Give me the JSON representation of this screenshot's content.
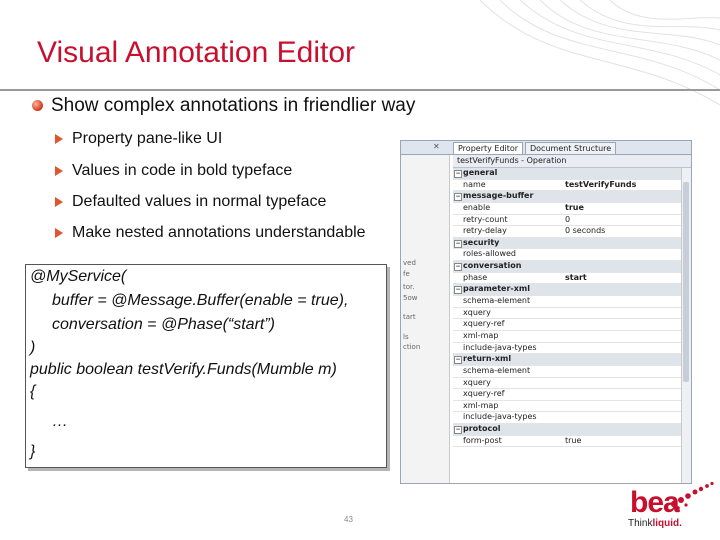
{
  "slide": {
    "title": "Visual Annotation Editor",
    "bullet": "Show complex annotations in friendlier way",
    "sub_bullets": [
      "Property pane-like UI",
      "Values in code in bold typeface",
      "Defaulted values in normal typeface",
      "Make nested annotations understandable"
    ],
    "page_number": "43",
    "brand_color": "#c8102e"
  },
  "code": {
    "lines": [
      "@MyService(",
      "buffer = @Message.Buffer(enable = true),",
      "conversation = @Phase(“start”)",
      ")",
      "public boolean testVerify.Funds(Mumble m)",
      "{",
      "…",
      "}"
    ]
  },
  "editor": {
    "tabs": [
      "Property Editor",
      "Document Structure"
    ],
    "header": "testVerifyFunds - Operation",
    "left_fragments": [
      "ved",
      "fe",
      "tor.",
      "5ow",
      "tart",
      "ls",
      "ction"
    ],
    "rows": [
      {
        "key": "general",
        "value": "",
        "category": true,
        "bold": false
      },
      {
        "key": "name",
        "value": "testVerifyFunds",
        "category": false,
        "bold": true
      },
      {
        "key": "message-buffer",
        "value": "",
        "category": true,
        "bold": false
      },
      {
        "key": "enable",
        "value": "true",
        "category": false,
        "bold": true
      },
      {
        "key": "retry-count",
        "value": "0",
        "category": false,
        "bold": false
      },
      {
        "key": "retry-delay",
        "value": "0 seconds",
        "category": false,
        "bold": false
      },
      {
        "key": "security",
        "value": "",
        "category": true,
        "bold": false
      },
      {
        "key": "roles-allowed",
        "value": "",
        "category": false,
        "bold": false
      },
      {
        "key": "conversation",
        "value": "",
        "category": true,
        "bold": false
      },
      {
        "key": "phase",
        "value": "start",
        "category": false,
        "bold": true
      },
      {
        "key": "parameter-xml",
        "value": "",
        "category": true,
        "bold": false
      },
      {
        "key": "schema-element",
        "value": "",
        "category": false,
        "bold": false
      },
      {
        "key": "xquery",
        "value": "",
        "category": false,
        "bold": false
      },
      {
        "key": "xquery-ref",
        "value": "",
        "category": false,
        "bold": false
      },
      {
        "key": "xml-map",
        "value": "",
        "category": false,
        "bold": false
      },
      {
        "key": "include-java-types",
        "value": "",
        "category": false,
        "bold": false
      },
      {
        "key": "return-xml",
        "value": "",
        "category": true,
        "bold": false
      },
      {
        "key": "schema-element",
        "value": "",
        "category": false,
        "bold": false
      },
      {
        "key": "xquery",
        "value": "",
        "category": false,
        "bold": false
      },
      {
        "key": "xquery-ref",
        "value": "",
        "category": false,
        "bold": false
      },
      {
        "key": "xml-map",
        "value": "",
        "category": false,
        "bold": false
      },
      {
        "key": "include-java-types",
        "value": "",
        "category": false,
        "bold": false
      },
      {
        "key": "protocol",
        "value": "",
        "category": true,
        "bold": false
      },
      {
        "key": "form-post",
        "value": "true",
        "category": false,
        "bold": false
      }
    ]
  },
  "logo": {
    "mark": "bea",
    "tag_think": "Think",
    "tag_liquid": "liquid."
  }
}
